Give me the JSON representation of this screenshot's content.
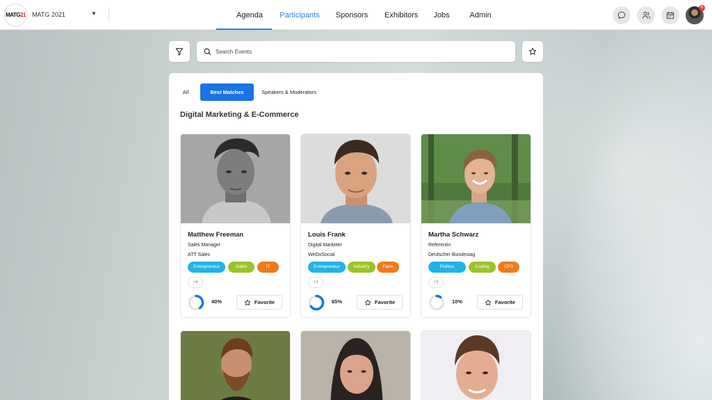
{
  "header": {
    "logo_text_a": "MATG",
    "logo_text_b": "21",
    "event_name": "MATG 2021",
    "nav": [
      {
        "label": "Agenda",
        "active": false
      },
      {
        "label": "Participants",
        "active": true
      },
      {
        "label": "Sponsors",
        "active": false
      },
      {
        "label": "Exhibitors",
        "active": false
      },
      {
        "label": "Jobs",
        "active": false
      },
      {
        "label": "Admin",
        "active": false
      }
    ],
    "icons": [
      "chat-icon",
      "people-icon",
      "calendar-icon"
    ],
    "notification_count": "6"
  },
  "search": {
    "placeholder": "Search Events"
  },
  "tabs": [
    {
      "label": "All",
      "active": false
    },
    {
      "label": "Best Matches",
      "active": true
    },
    {
      "label": "Speakers & Moderators",
      "active": false
    }
  ],
  "section_title": "Digital Marketing & E-Commerce",
  "favorite_label": "Favorite",
  "colors": {
    "accent": "#2f7de1",
    "tag_blue": "#22b3e6",
    "tag_green": "#9bc32a",
    "tag_orange": "#f07a1e"
  },
  "participants": [
    {
      "name": "Matthew Freeman",
      "role": "Sales Manager",
      "company": "ATT Sales",
      "tags": [
        {
          "label": "Entrepreneur",
          "color": "#22b3e6"
        },
        {
          "label": "Sales",
          "color": "#9bc32a"
        },
        {
          "label": "IT",
          "color": "#f07a1e"
        }
      ],
      "more": "+4",
      "match": "40%",
      "match_fraction": 0.4
    },
    {
      "name": "Louis Frank",
      "role": "Digital Marketer",
      "company": "WeDoSocial",
      "tags": [
        {
          "label": "Entrepreneur",
          "color": "#22b3e6"
        },
        {
          "label": "Industry",
          "color": "#9bc32a"
        },
        {
          "label": "Farm",
          "color": "#f07a1e"
        }
      ],
      "more": "+3",
      "match": "65%",
      "match_fraction": 0.65
    },
    {
      "name": "Martha Schwarz",
      "role": "Referentin",
      "company": "Deutscher Bundestag",
      "tags": [
        {
          "label": "Politics",
          "color": "#22b3e6"
        },
        {
          "label": "Coding",
          "color": "#9bc32a"
        },
        {
          "label": "CP3",
          "color": "#f07a1e"
        }
      ],
      "more": "+3",
      "match": "10%",
      "match_fraction": 0.1
    }
  ]
}
